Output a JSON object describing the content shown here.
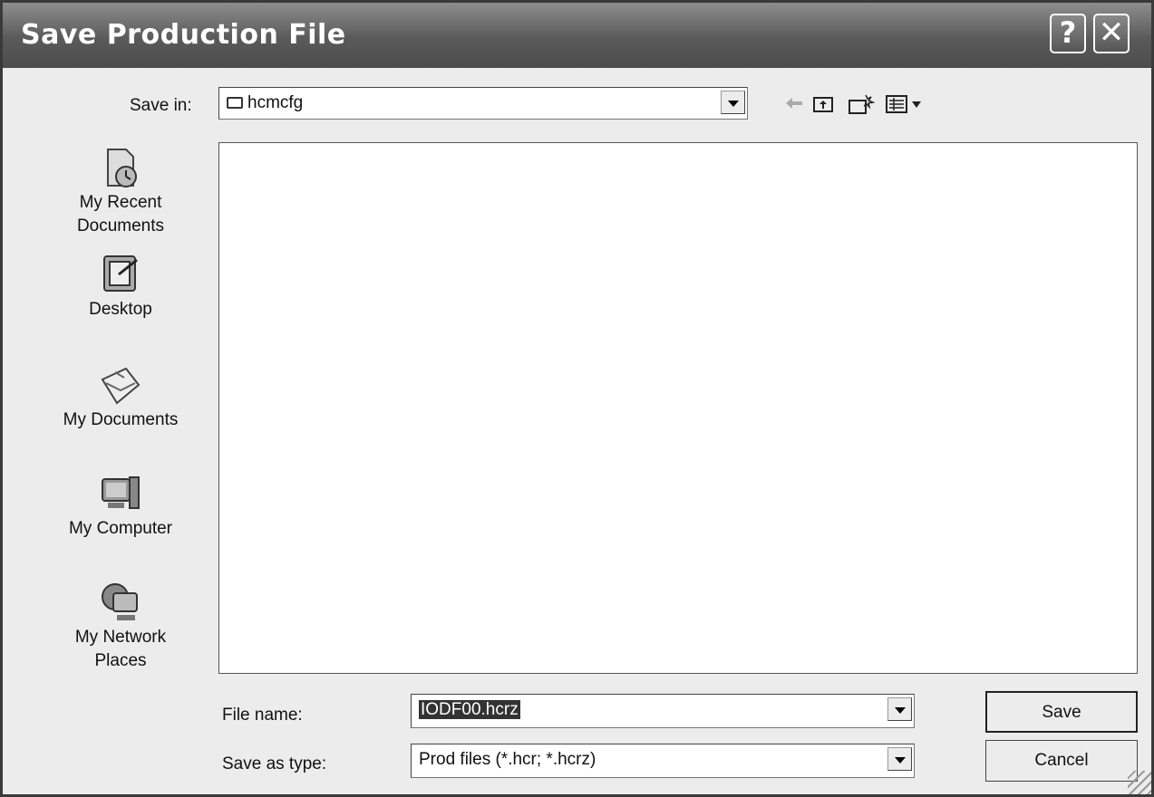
{
  "dialog": {
    "title": "Save Production File",
    "help_glyph": "?",
    "close_glyph": "✕"
  },
  "toolbar": {
    "save_in_label": "Save in:",
    "save_in_value": "hcmcfg",
    "icons": [
      "back-arrow-icon",
      "up-folder-icon",
      "new-folder-icon",
      "view-menu-icon"
    ]
  },
  "places": [
    {
      "label_line1": "My Recent",
      "label_line2": "Documents",
      "icon": "recent-documents-icon"
    },
    {
      "label_line1": "Desktop",
      "label_line2": "",
      "icon": "desktop-icon"
    },
    {
      "label_line1": "My Documents",
      "label_line2": "",
      "icon": "my-documents-icon"
    },
    {
      "label_line1": "My Computer",
      "label_line2": "",
      "icon": "my-computer-icon"
    },
    {
      "label_line1": "My Network",
      "label_line2": "Places",
      "icon": "network-places-icon"
    }
  ],
  "form": {
    "file_name_label": "File name:",
    "file_name_value": "IODF00.hcrz",
    "save_as_type_label": "Save as type:",
    "save_as_type_value": "Prod files (*.hcr; *.hcrz)"
  },
  "buttons": {
    "save": "Save",
    "cancel": "Cancel"
  }
}
